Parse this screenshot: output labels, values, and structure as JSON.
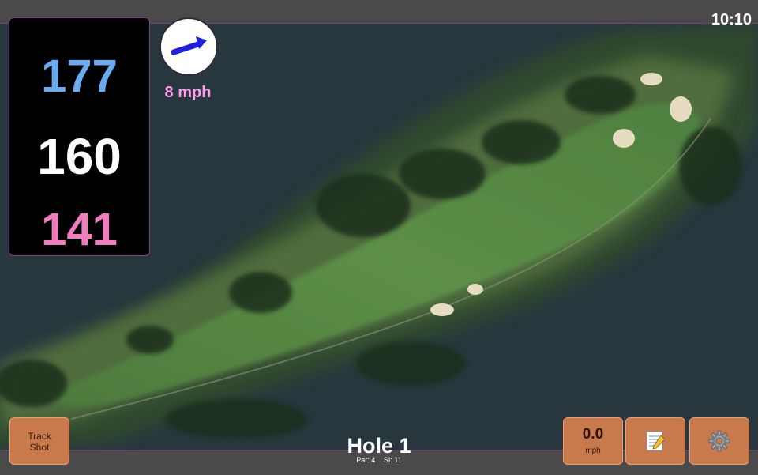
{
  "status": {
    "time": "10:10"
  },
  "distances": {
    "back": "177",
    "middle": "160",
    "front": "141"
  },
  "wind": {
    "speed": "8 mph",
    "direction_icon": "wind-arrow-icon"
  },
  "hole": {
    "title": "Hole 1",
    "par": "Par: 4",
    "stroke_index": "SI: 11"
  },
  "buttons": {
    "track_line1": "Track",
    "track_line2": "Shot",
    "speed_value": "0.0",
    "speed_unit": "mph",
    "notes_icon": "notepad-icon",
    "settings_icon": "gear-icon"
  },
  "colors": {
    "back_distance": "#6aaaf0",
    "middle_distance": "#ffffff",
    "front_distance": "#f17cc0",
    "button_fill": "#c97a4c",
    "accent_border": "#7c3b7e"
  }
}
